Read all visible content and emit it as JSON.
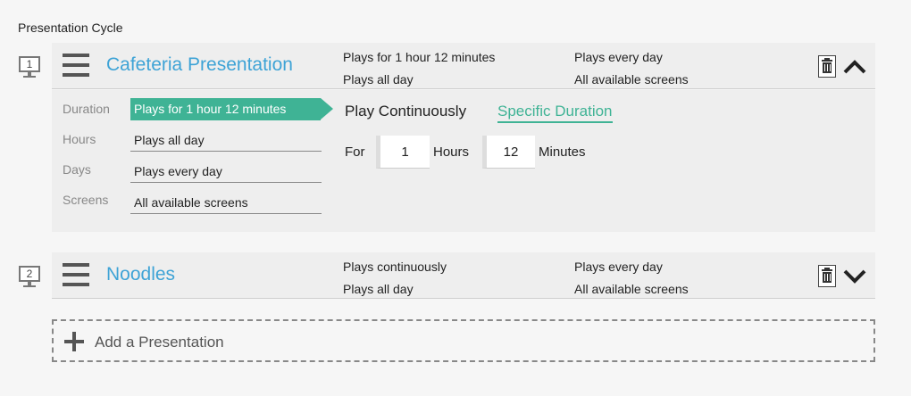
{
  "section_title": "Presentation Cycle",
  "presentations": [
    {
      "number": "1",
      "name": "Cafeteria Presentation",
      "duration_summary": "Plays for 1 hour 12 minutes",
      "hours_summary": "Plays all day",
      "days_summary": "Plays every day",
      "screens_summary": "All available screens",
      "expanded": true,
      "toggle_icon": "chevron-up-icon"
    },
    {
      "number": "2",
      "name": "Noodles",
      "duration_summary": "Plays continuously",
      "hours_summary": "Plays all day",
      "days_summary": "Plays every day",
      "screens_summary": "All available screens",
      "expanded": false,
      "toggle_icon": "chevron-down-icon"
    }
  ],
  "details": {
    "labels": {
      "duration": "Duration",
      "hours": "Hours",
      "days": "Days",
      "screens": "Screens"
    },
    "values": {
      "duration": "Plays for 1 hour 12 minutes",
      "hours": "Plays all day",
      "days": "Plays every day",
      "screens": "All available screens"
    },
    "options": {
      "continuous": "Play Continuously",
      "specific": "Specific Duration",
      "selected": "specific"
    },
    "for_label": "For",
    "hours_value": "1",
    "hours_unit": "Hours",
    "minutes_value": "12",
    "minutes_unit": "Minutes"
  },
  "add_presentation": {
    "label": "Add a Presentation"
  },
  "colors": {
    "accent_blue": "#3ea3d6",
    "accent_green": "#3fb395",
    "panel": "#eeeeee",
    "background": "#f6f6f6"
  }
}
